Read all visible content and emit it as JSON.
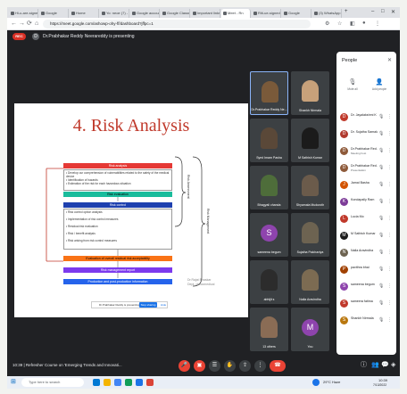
{
  "browser": {
    "tabs": [
      "Hi-u-are-signed-",
      "Google",
      "Home",
      "Yo: neoe (7) - meet",
      "Google account",
      "Google Classr",
      "Important links",
      "Meet - Rn",
      "Riti-ue-signed",
      "Google",
      "(3) WhatsApp"
    ],
    "url": "https://meet.google.com/ashowp-ohy-ff/dashboard?jffpc=1",
    "new_tab": "+"
  },
  "meet": {
    "rec": "REC",
    "presenter_icon": "D",
    "presenting": "Dr.Prabhakar Reddy Neerareddy is presenting",
    "meeting_info": "10:39   |  Refresher Course on 'Emerging Trends and Innovati..."
  },
  "slide": {
    "title": "4. Risk Analysis",
    "blocks": [
      {
        "header": "Risk analysis",
        "lines": [
          "• Develop our comprehension of vulnerabilities related to the safety of the medical device",
          "• Identification of hazards",
          "• Estimation of the risk for each hazardous situation"
        ]
      },
      {
        "header": "Risk evaluation",
        "lines": []
      },
      {
        "header": "Risk control",
        "lines": [
          "• Risk control option analysis",
          "• Implementation of risk control measures",
          "• Residual risk evaluation",
          "• Risk / benefit analysis",
          "• Risk arising from risk control measures"
        ]
      },
      {
        "header": "Evaluation of overall residual risk acceptability",
        "lines": []
      },
      {
        "header": "Risk management report",
        "lines": []
      },
      {
        "header": "Production and post-production information",
        "lines": []
      }
    ],
    "side_labels": {
      "assessment": "Risk Assessment",
      "management": "Risk Management"
    },
    "cite": [
      "Dr.Rajat Bhaskar",
      "Dept. of Biomedical"
    ],
    "dialog_text": "Dr.Prabhakar Reddy is presenting to everyone",
    "dialog_button": "Stop sharing",
    "dialog_hide": "Hide"
  },
  "tiles": [
    {
      "name": "Dr.Prabhakar Reddy Ne...",
      "color": "#7a5a3a",
      "type": "photo"
    },
    {
      "name": "Shankh Nirmala",
      "color": "#c7a17a",
      "type": "photo"
    },
    {
      "name": "Syed Imam Pasha",
      "color": "#5a4838",
      "type": "photo"
    },
    {
      "name": "M Sathish Kumar",
      "color": "#1b1b1b",
      "type": "photo"
    },
    {
      "name": "Bhagyali chanda",
      "color": "#4e6d3a",
      "type": "photo"
    },
    {
      "name": "Shyamala Muduroth",
      "color": "#6b5b4b",
      "type": "photo"
    },
    {
      "name": "sameena begum",
      "color": "#8e44ad",
      "type": "avatar",
      "letter": "S"
    },
    {
      "name": "Sujatha Palchaviya",
      "color": "#6d6351",
      "type": "photo"
    },
    {
      "name": "abhijit s",
      "color": "#2c2c2c",
      "type": "photo"
    },
    {
      "name": "Nalla Aravindha",
      "color": "#7c6b52",
      "type": "photo"
    },
    {
      "name": "13 others",
      "color": "#8a6c55",
      "type": "photo"
    },
    {
      "name": "You",
      "color": "#8e44ad",
      "type": "avatar",
      "letter": "M"
    }
  ],
  "people": {
    "title": "People",
    "close": "✕",
    "mute_all": "Mute all",
    "add_people": "Add people",
    "list": [
      {
        "name": "Dr. Jayalakshmi K",
        "sub": "",
        "color": "#c0392b",
        "letter": "D"
      },
      {
        "name": "Dr. Sujatha Samala",
        "sub": "",
        "color": "#b03a2e",
        "letter": "D"
      },
      {
        "name": "Dr.Prabhakar Red...",
        "sub": "Meeting host",
        "color": "#8e5a3a",
        "letter": "D"
      },
      {
        "name": "Dr.Prabhakar Red...",
        "sub": "Presentation",
        "color": "#8e5a3a",
        "letter": "D"
      },
      {
        "name": "Jamal Basha",
        "sub": "",
        "color": "#d35400",
        "letter": "J"
      },
      {
        "name": "Kondapally Ram",
        "sub": "",
        "color": "#7d3c98",
        "letter": "K"
      },
      {
        "name": "Lucia Mo",
        "sub": "",
        "color": "#c0392b",
        "letter": "L"
      },
      {
        "name": "M Sathish Kumar",
        "sub": "",
        "color": "#1b1b1b",
        "letter": "M"
      },
      {
        "name": "Nalla Aravindha",
        "sub": "",
        "color": "#6d6351",
        "letter": "N"
      },
      {
        "name": "pavithra bhai",
        "sub": "",
        "color": "#a04000",
        "letter": "P"
      },
      {
        "name": "sameena begum",
        "sub": "",
        "color": "#8e44ad",
        "letter": "S"
      },
      {
        "name": "sameera fatima",
        "sub": "",
        "color": "#c0392b",
        "letter": "S"
      },
      {
        "name": "Shankh Nirmala",
        "sub": "",
        "color": "#b9770e",
        "letter": "S"
      }
    ]
  },
  "taskbar": {
    "search": "Type here to search",
    "weather": "29°C Haze",
    "time": "10:39",
    "date": "7/13/2022"
  }
}
